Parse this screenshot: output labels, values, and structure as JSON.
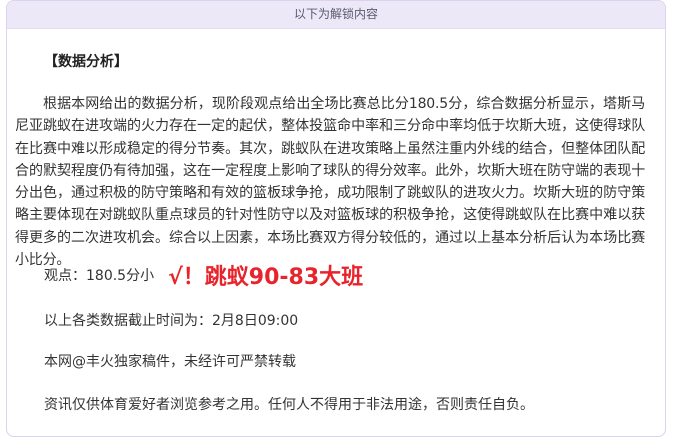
{
  "unlock_banner": "以下为解锁内容",
  "section_title": "【数据分析】",
  "analysis_paragraph": "根据本网给出的数据分析，现阶段观点给出全场比赛总比分180.5分，综合数据分析显示，塔斯马尼亚跳蚁在进攻端的火力存在一定的起伏，整体投篮命中率和三分命中率均低于坎斯大班，这使得球队在比赛中难以形成稳定的得分节奏。其次，跳蚁队在进攻策略上虽然注重内外线的结合，但整体团队配合的默契程度仍有待加强，这在一定程度上影响了球队的得分效率。此外，坎斯大班在防守端的表现十分出色，通过积极的防守策略和有效的篮板球争抢，成功限制了跳蚁队的进攻火力。坎斯大班的防守策略主要体现在对跳蚁队重点球员的针对性防守以及对篮板球的积极争抢，这使得跳蚁队在比赛中难以获得更多的二次进攻机会。综合以上因素，本场比赛双方得分较低的，通过以上基本分析后认为本场比赛小比分。",
  "opinion": {
    "label": "观点：180.5分小",
    "pick": "√！跳蚁90-83大班",
    "pick_color": "#e8232b"
  },
  "data_cutoff": "以上各类数据截止时间为：2月8日09:00",
  "copyright": "本网@丰火独家稿件，未经许可严禁转载",
  "disclaimer": "资讯仅供体育爱好者浏览参考之用。任何人不得用于非法用途，否则责任自负。"
}
